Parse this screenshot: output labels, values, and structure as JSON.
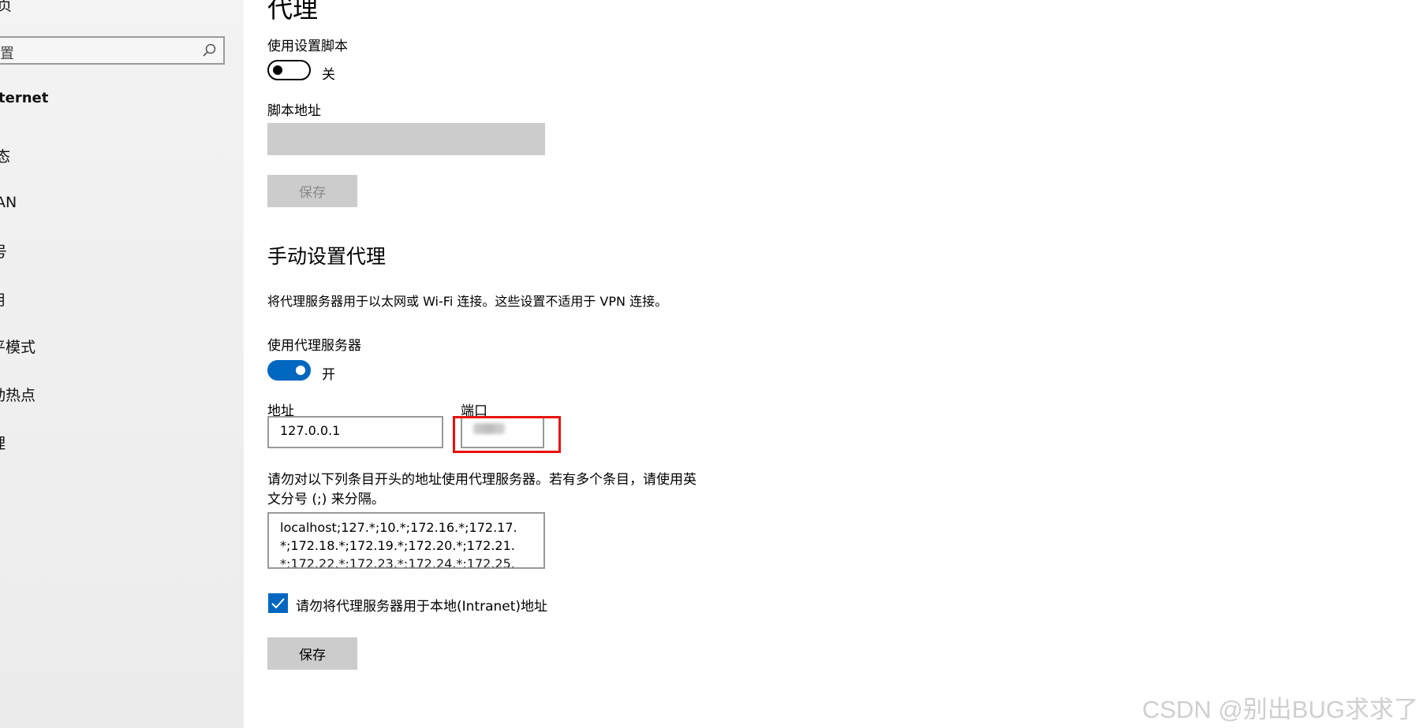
{
  "sidebar": {
    "top_partial": "页",
    "search_placeholder": "置",
    "heading": "ternet",
    "items": [
      "态",
      "AN",
      "号",
      "用",
      "平模式",
      "动热点",
      "理"
    ]
  },
  "page": {
    "title": "代理"
  },
  "auto": {
    "script_label": "使用设置脚本",
    "script_toggle_state": "关",
    "script_address_label": "脚本地址",
    "save_label": "保存"
  },
  "manual": {
    "title": "手动设置代理",
    "description": "将代理服务器用于以太网或 Wi-Fi 连接。这些设置不适用于 VPN 连接。",
    "use_proxy_label": "使用代理服务器",
    "use_proxy_state": "开",
    "address_label": "地址",
    "address_value": "127.0.0.1",
    "port_label": "端口",
    "exceptions_label_line1": "请勿对以下列条目开头的地址使用代理服务器。若有多个条目，请使用英",
    "exceptions_label_line2": "文分号 (;) 来分隔。",
    "exceptions_lines": [
      "localhost;127.*;10.*;172.16.*;172.17.",
      "*;172.18.*;172.19.*;172.20.*;172.21.",
      "*;172.22.*;172.23.*;172.24.*;172.25."
    ],
    "bypass_local_label": "请勿将代理服务器用于本地(Intranet)地址",
    "bypass_local_checked": true,
    "save_label": "保存"
  },
  "watermark": "CSDN @别出BUG求求了",
  "colors": {
    "accent": "#0067c0",
    "highlight": "#e81010",
    "disabled_fill": "#cccccc",
    "sidebar_bg": "#f0f0f0"
  }
}
